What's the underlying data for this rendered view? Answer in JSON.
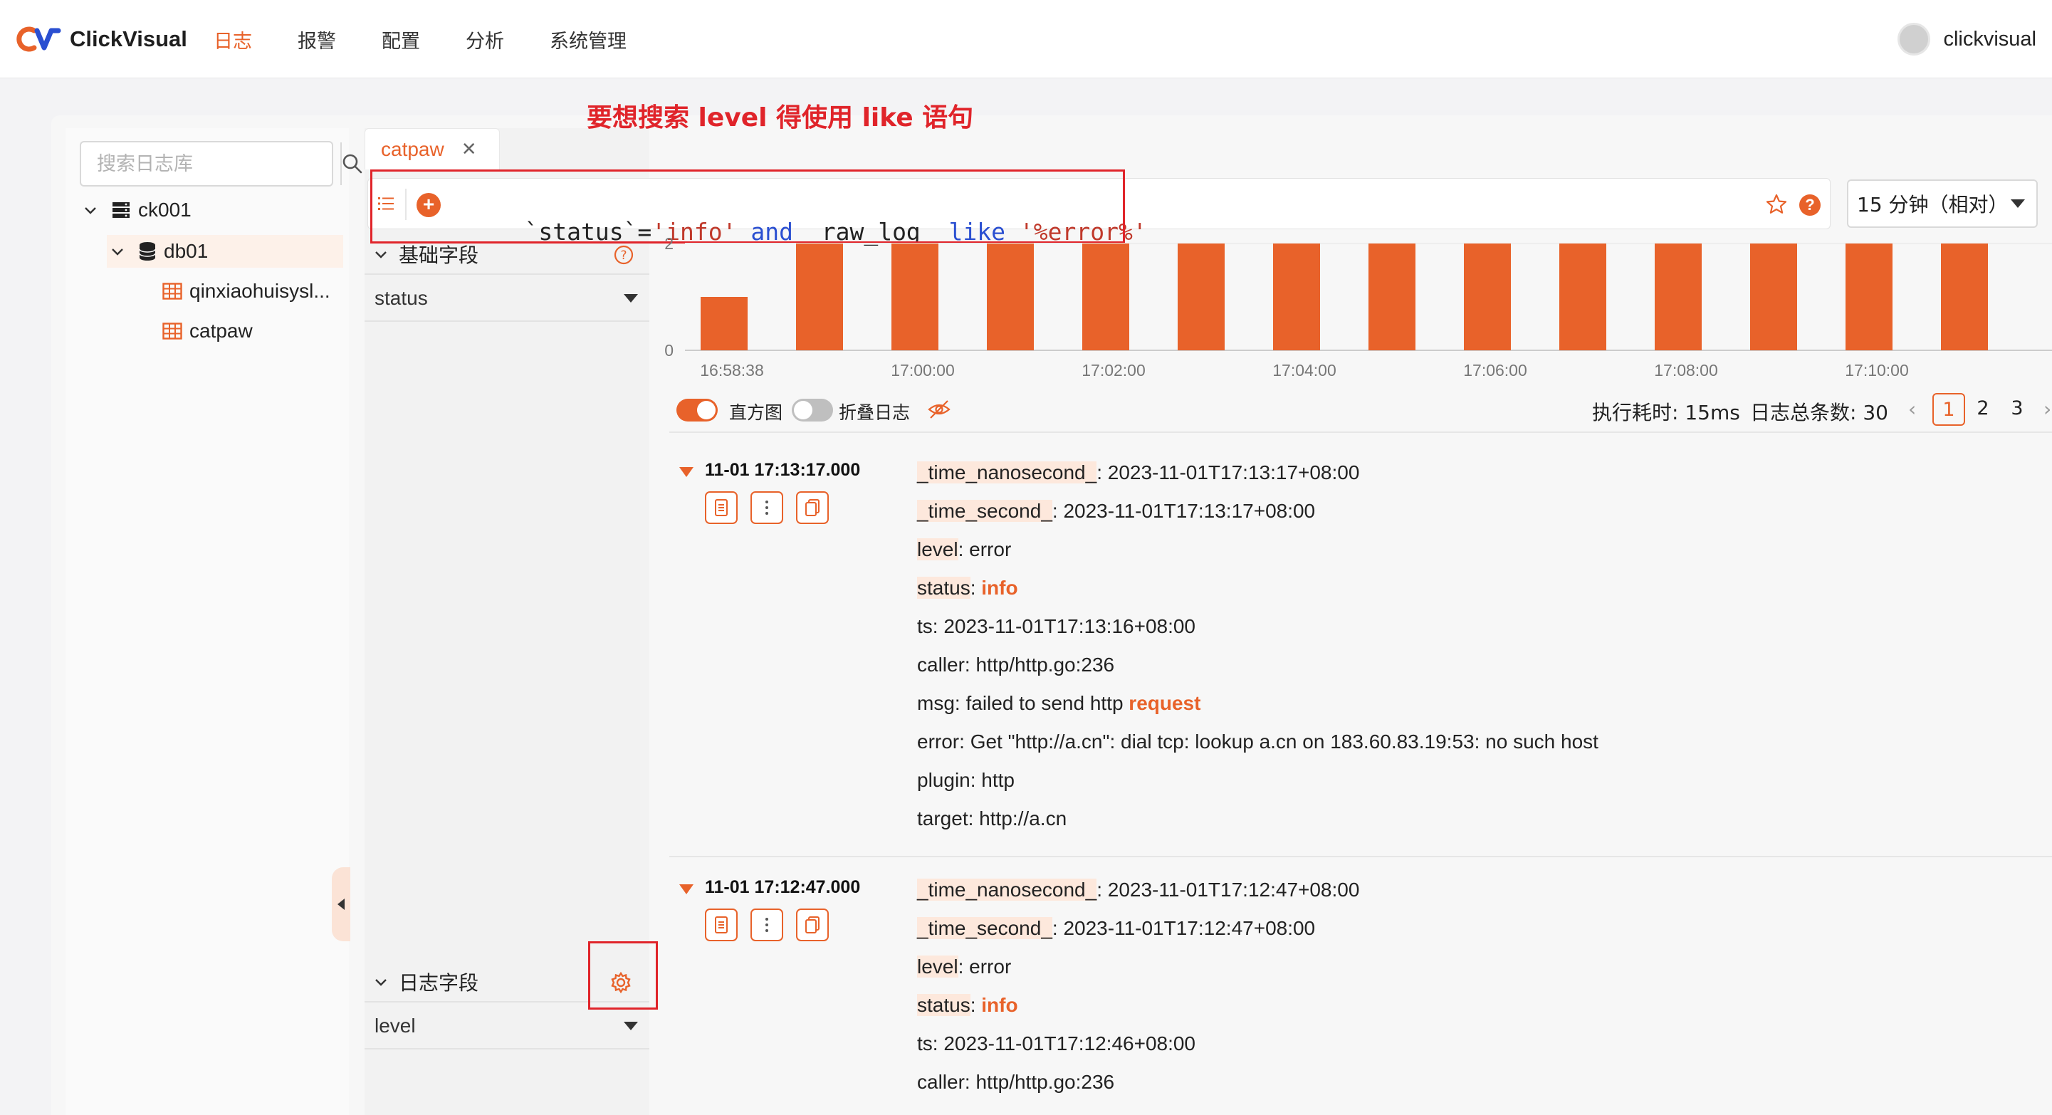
{
  "app": {
    "name": "ClickVisual"
  },
  "nav": {
    "items": [
      {
        "label": "日志",
        "active": true
      },
      {
        "label": "报警",
        "active": false
      },
      {
        "label": "配置",
        "active": false
      },
      {
        "label": "分析",
        "active": false
      },
      {
        "label": "系统管理",
        "active": false
      }
    ]
  },
  "user": {
    "name": "clickvisual"
  },
  "sidebar": {
    "search_placeholder": "搜索日志库",
    "tree": [
      {
        "label": "ck001",
        "icon": "server-icon"
      },
      {
        "label": "db01",
        "icon": "database-icon",
        "selected": true
      },
      {
        "label": "qinxiaohuisysl...",
        "icon": "table-icon"
      },
      {
        "label": "catpaw",
        "icon": "table-icon"
      }
    ]
  },
  "tab": {
    "label": "catpaw"
  },
  "query": {
    "parts": [
      {
        "text": "`status`=",
        "kind": "plain"
      },
      {
        "text": "'info'",
        "kind": "str"
      },
      {
        "text": " and ",
        "kind": "kw"
      },
      {
        "text": "_raw_log_ ",
        "kind": "plain"
      },
      {
        "text": "like",
        "kind": "kw"
      },
      {
        "text": " ",
        "kind": "plain"
      },
      {
        "text": "'%error%'",
        "kind": "str"
      }
    ]
  },
  "time_range": {
    "value": "15 分钟（相对）"
  },
  "annotation": {
    "text": "要想搜索 level 得使用 like 语句"
  },
  "fields": {
    "base_title": "基础字段",
    "base_select": "status",
    "log_title": "日志字段",
    "log_select": "level"
  },
  "chart_data": {
    "type": "bar",
    "color": "#e8622a",
    "ylim": [
      0,
      2
    ],
    "yticks": [
      "2",
      "0"
    ],
    "xticks": [
      "16:58:38",
      "17:00:00",
      "17:02:00",
      "17:04:00",
      "17:06:00",
      "17:08:00",
      "17:10:00"
    ],
    "values": [
      1,
      2,
      2,
      2,
      2,
      2,
      2,
      2,
      2,
      2,
      2,
      2,
      2,
      2
    ]
  },
  "toolbar": {
    "histogram_label": "直方图",
    "histogram_on": true,
    "fold_label": "折叠日志",
    "fold_on": false,
    "exec_time": "执行耗时: 15ms",
    "total": "日志总条数: 30",
    "pages": [
      "1",
      "2",
      "3"
    ],
    "current_page": "1"
  },
  "logs": [
    {
      "time": "11-01 17:13:17.000",
      "fields": [
        {
          "key": "_time_nanosecond_",
          "value": "2023-11-01T17:13:17+08:00"
        },
        {
          "key": "_time_second_",
          "value": "2023-11-01T17:13:17+08:00"
        },
        {
          "key": "level",
          "value": "error"
        },
        {
          "key": "status",
          "value": "info",
          "highlight": true
        },
        {
          "key": "ts",
          "value": "2023-11-01T17:13:16+08:00"
        },
        {
          "key": "caller",
          "value": "http/http.go:236"
        },
        {
          "key": "msg",
          "value": "failed to send http ",
          "value_hl": "request"
        },
        {
          "key": "error",
          "value": "Get \"http://a.cn\": dial tcp: lookup a.cn on 183.60.83.19:53: no such host"
        },
        {
          "key": "plugin",
          "value": "http"
        },
        {
          "key": "target",
          "value": "http://a.cn"
        }
      ]
    },
    {
      "time": "11-01 17:12:47.000",
      "fields": [
        {
          "key": "_time_nanosecond_",
          "value": "2023-11-01T17:12:47+08:00"
        },
        {
          "key": "_time_second_",
          "value": "2023-11-01T17:12:47+08:00"
        },
        {
          "key": "level",
          "value": "error"
        },
        {
          "key": "status",
          "value": "info",
          "highlight": true
        },
        {
          "key": "ts",
          "value": "2023-11-01T17:12:46+08:00"
        },
        {
          "key": "caller",
          "value": "http/http.go:236"
        }
      ]
    }
  ]
}
